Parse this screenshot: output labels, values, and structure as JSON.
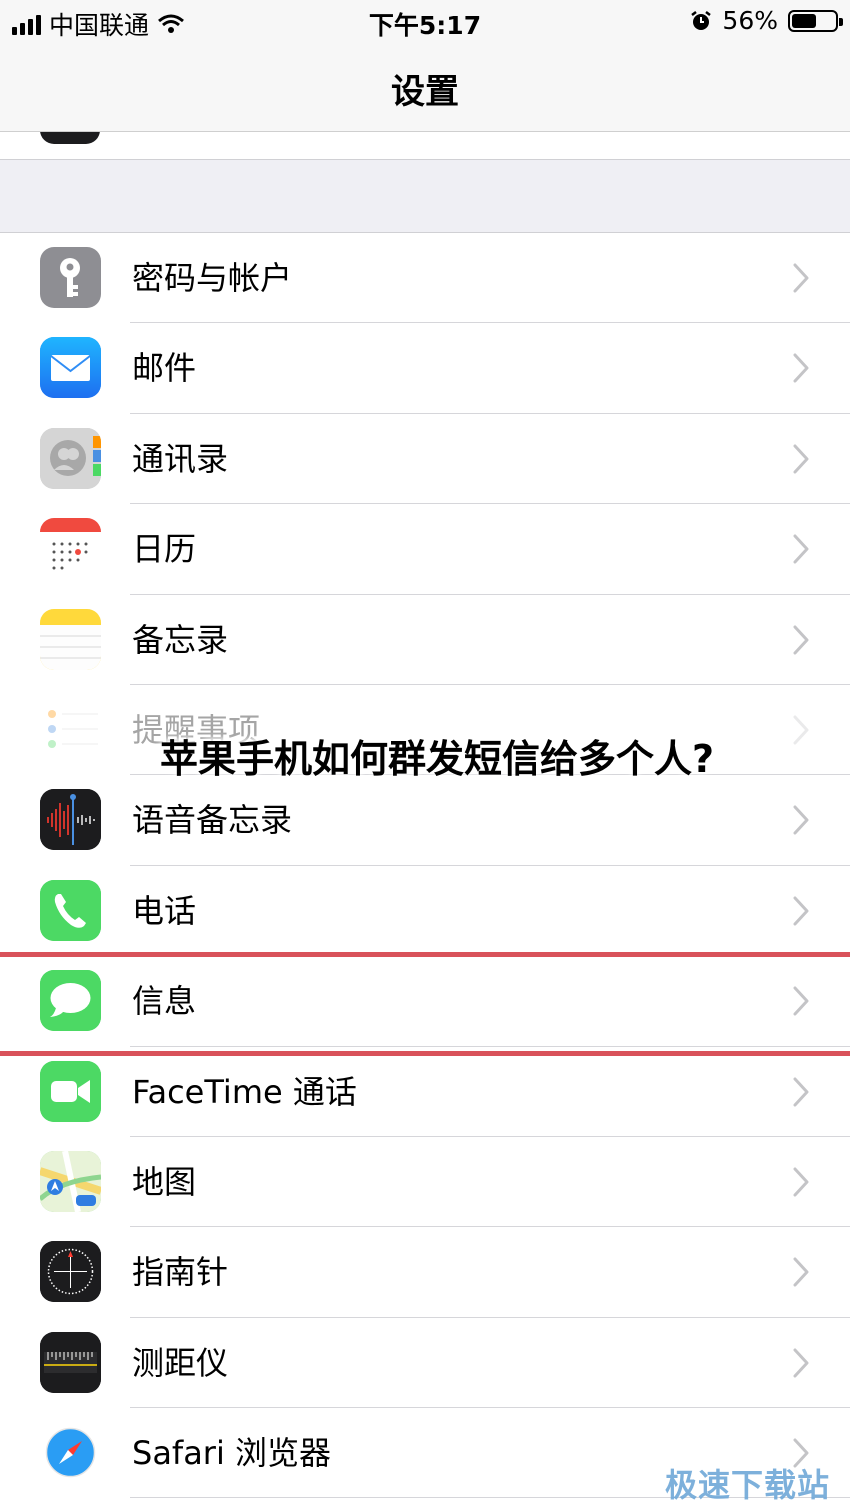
{
  "status_bar": {
    "carrier": "中国联通",
    "time": "下午5:17",
    "battery_text": "56%",
    "battery_level": 0.56
  },
  "nav": {
    "title": "设置"
  },
  "rows": [
    {
      "label": "密码与帐户",
      "icon": "key-icon",
      "color": "#8e8e93"
    },
    {
      "label": "邮件",
      "icon": "mail-icon",
      "color": "#2f8df5"
    },
    {
      "label": "通讯录",
      "icon": "contacts-icon",
      "color": "#c9c9c9"
    },
    {
      "label": "日历",
      "icon": "calendar-icon",
      "color": "#ffffff"
    },
    {
      "label": "备忘录",
      "icon": "notes-icon",
      "color": "#ffd93b"
    },
    {
      "label": "提醒事项",
      "icon": "reminders-icon",
      "color": "#ffffff"
    },
    {
      "label": "语音备忘录",
      "icon": "voice-memos-icon",
      "color": "#1c1c1e"
    },
    {
      "label": "电话",
      "icon": "phone-icon",
      "color": "#4cd964"
    },
    {
      "label": "信息",
      "icon": "messages-icon",
      "color": "#4cd964"
    },
    {
      "label": "FaceTime 通话",
      "icon": "facetime-icon",
      "color": "#4cd964"
    },
    {
      "label": "地图",
      "icon": "maps-icon",
      "color": "#8ed58f"
    },
    {
      "label": "指南针",
      "icon": "compass-icon",
      "color": "#1c1c1e"
    },
    {
      "label": "测距仪",
      "icon": "measure-icon",
      "color": "#1c1c1e"
    },
    {
      "label": "Safari 浏览器",
      "icon": "safari-icon",
      "color": "#ffffff"
    }
  ],
  "overlay": {
    "title": "苹果手机如何群发短信给多个人?"
  },
  "watermark": {
    "text": "极速下载站"
  },
  "colors": {
    "highlight": "#d9525a",
    "group_background": "#efeff4"
  }
}
